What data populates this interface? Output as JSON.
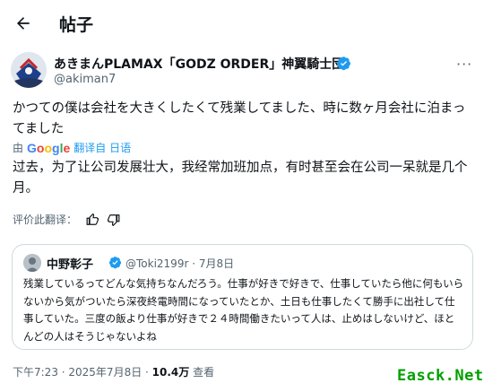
{
  "header": {
    "title": "帖子"
  },
  "author": {
    "name": "あきまんPLAMAX「GODZ ORDER」神翼騎士団",
    "handle": "@akiman7"
  },
  "tweet": {
    "original_text": "かつての僕は会社を大きくしたくて残業してました、時に数ヶ月会社に泊まってました",
    "translated_prefix": "由",
    "translated_brand": "Google",
    "translated_from": "翻译自 日语",
    "translation_text": "过去，为了让公司发展壮大，我经常加班加点，有时甚至会在公司一呆就是几个月。",
    "rate_label": "评价此翻译："
  },
  "quote": {
    "name": "中野彰子",
    "meta": "@Toki2199r · 7月8日",
    "text": "残業しているってどんな気持ちなんだろう。仕事が好きで好きで、仕事していたら他に何もいらないから気がついたら深夜終電時間になっていたとか、土日も仕事したくて勝手に出社して仕事していた。三度の飯より仕事が好きで２４時間働きたいって人は、止めはしないけど、ほとんどの人はそうじゃないよね"
  },
  "footer": {
    "time": "下午7:23 · 2025年7月8日 · ",
    "views_count": "10.4万",
    "views_label": " 查看"
  },
  "watermark": "Easck.Net",
  "colors": {
    "accent": "#1d9bf0",
    "muted": "#536471",
    "watermark": "#00a000"
  }
}
